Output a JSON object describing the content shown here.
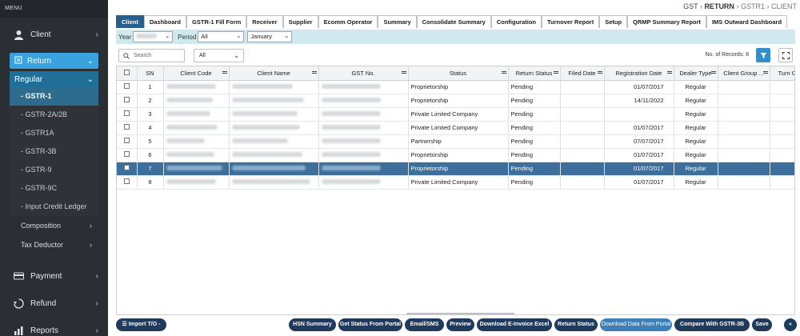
{
  "sidebar": {
    "menu_title": "MENU",
    "client": "Client",
    "return": "Return",
    "regular": "Regular",
    "gst_items": [
      "- GSTR-1",
      "- GSTR-2A/2B",
      "- GSTR1A",
      "- GSTR-3B",
      "- GSTR-9",
      "- GSTR-9C",
      "- Input Credit Ledger"
    ],
    "composition": "Composition",
    "tax_deductor": "Tax Deductor",
    "payment": "Payment",
    "refund": "Refund",
    "reports": "Reports"
  },
  "breadcrumb": {
    "a": "GST",
    "b": "RETURN",
    "c": "GSTR1",
    "d": "CLIENT"
  },
  "tabs": [
    "Client",
    "Dashboard",
    "GSTR-1 Fill Form",
    "Receiver",
    "Supplier",
    "Ecomm Operator",
    "Summary",
    "Consolidate Summary",
    "Configuration",
    "Turnover Report",
    "Setup",
    "QRMP Summary Report",
    "IMS Outward Dashboard"
  ],
  "filter": {
    "year_label": "Year",
    "period_label": "Period",
    "period_value": "All",
    "month_value": "January"
  },
  "search": {
    "placeholder": "Search",
    "scope": "All",
    "records": "No. of Records: 8"
  },
  "table": {
    "headers": [
      "SN",
      "Client Code",
      "Client Name",
      "GST No.",
      "Status",
      "Return Status",
      "Filed Date",
      "Registration Date",
      "Dealer Type",
      "Client Group ...",
      "Turn O"
    ],
    "rows": [
      {
        "sn": "1",
        "status": "Proprietorship",
        "return_status": "Pending",
        "filed": "",
        "reg_date": "01/07/2017",
        "dealer": "Regular",
        "selected": false
      },
      {
        "sn": "2",
        "status": "Proprietorship",
        "return_status": "Pending",
        "filed": "",
        "reg_date": "14/11/2022",
        "dealer": "Regular",
        "selected": false
      },
      {
        "sn": "3",
        "status": "Private Limited Company",
        "return_status": "Pending",
        "filed": "",
        "reg_date": "",
        "dealer": "Regular",
        "selected": false
      },
      {
        "sn": "4",
        "status": "Private Limited Company",
        "return_status": "Pending",
        "filed": "",
        "reg_date": "01/07/2017",
        "dealer": "Regular",
        "selected": false
      },
      {
        "sn": "5",
        "status": "Partnership",
        "return_status": "Pending",
        "filed": "",
        "reg_date": "07/07/2017",
        "dealer": "Regular",
        "selected": false
      },
      {
        "sn": "6",
        "status": "Proprietorship",
        "return_status": "Pending",
        "filed": "",
        "reg_date": "01/07/2017",
        "dealer": "Regular",
        "selected": false
      },
      {
        "sn": "7",
        "status": "Proprietorship",
        "return_status": "Pending",
        "filed": "",
        "reg_date": "01/07/2017",
        "dealer": "Regular",
        "selected": true
      },
      {
        "sn": "8",
        "status": "Private Limited Company",
        "return_status": "Pending",
        "filed": "",
        "reg_date": "01/07/2017",
        "dealer": "Regular",
        "selected": false
      }
    ]
  },
  "bottom": {
    "import": "Import T/O -",
    "hsn": "HSN Summary",
    "get_status": "Get Status From Portal",
    "email": "Email/SMS",
    "preview": "Preview",
    "einvoice": "Download E-Invoice Excel",
    "return_status": "Return Status",
    "download_portal": "Download Data From Portal",
    "compare": "Compare With GSTR-3B",
    "save": "Save"
  },
  "colors": {
    "sidebar_bg": "#2b2e33",
    "accent": "#3aa3dd",
    "tab_active": "#27608f",
    "selected_row": "#3c6f9c",
    "button": "#1f3a5c"
  }
}
